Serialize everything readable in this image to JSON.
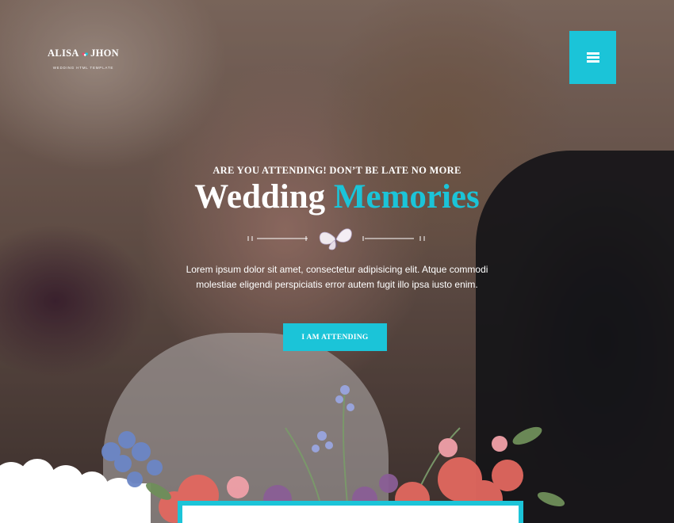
{
  "brand": {
    "name_left": "ALISA",
    "name_right": "JHON",
    "tagline": "WEDDING HTML TEMPLATE",
    "accent_color": "#1bc4d8"
  },
  "header": {
    "menu_icon": "hamburger-menu-icon"
  },
  "hero": {
    "eyebrow": "ARE YOU ATTENDING! DON’T BE LATE NO MORE",
    "title_main": "Wedding",
    "title_accent": "Memories",
    "divider_icon": "butterfly-icon",
    "description": "Lorem ipsum dolor sit amet, consectetur adipisicing elit. Atque commodi molestiae eligendi perspiciatis error autem fugit illo ipsa iusto enim.",
    "cta_label": "I AM ATTENDING"
  }
}
